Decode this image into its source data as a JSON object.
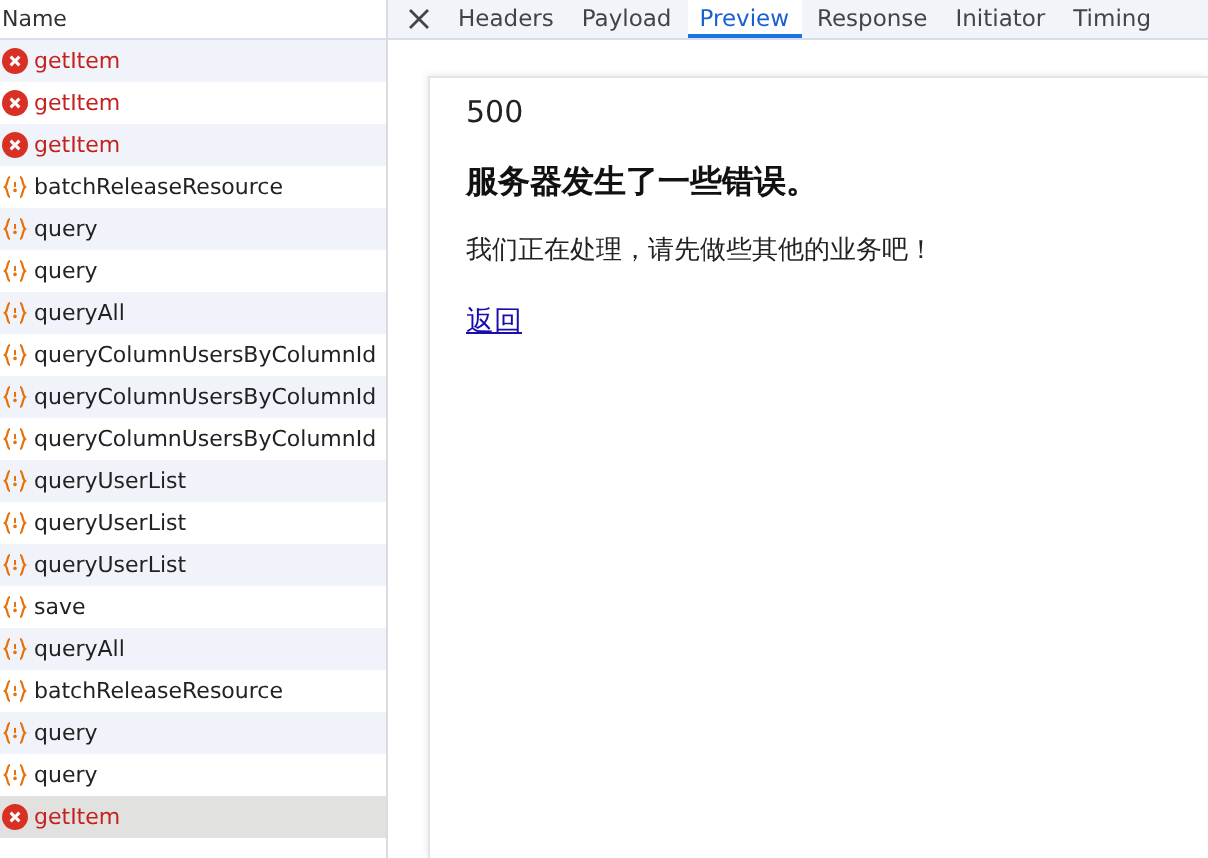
{
  "requests": {
    "column": "Name",
    "rows": [
      {
        "name": "getItem",
        "kind": "error",
        "selected": false
      },
      {
        "name": "getItem",
        "kind": "error",
        "selected": false
      },
      {
        "name": "getItem",
        "kind": "error",
        "selected": false
      },
      {
        "name": "batchReleaseResource",
        "kind": "fetch",
        "selected": false
      },
      {
        "name": "query",
        "kind": "fetch",
        "selected": false
      },
      {
        "name": "query",
        "kind": "fetch",
        "selected": false
      },
      {
        "name": "queryAll",
        "kind": "fetch",
        "selected": false
      },
      {
        "name": "queryColumnUsersByColumnId",
        "kind": "fetch",
        "selected": false
      },
      {
        "name": "queryColumnUsersByColumnId",
        "kind": "fetch",
        "selected": false
      },
      {
        "name": "queryColumnUsersByColumnId",
        "kind": "fetch",
        "selected": false
      },
      {
        "name": "queryUserList",
        "kind": "fetch",
        "selected": false
      },
      {
        "name": "queryUserList",
        "kind": "fetch",
        "selected": false
      },
      {
        "name": "queryUserList",
        "kind": "fetch",
        "selected": false
      },
      {
        "name": "save",
        "kind": "fetch",
        "selected": false
      },
      {
        "name": "queryAll",
        "kind": "fetch",
        "selected": false
      },
      {
        "name": "batchReleaseResource",
        "kind": "fetch",
        "selected": false
      },
      {
        "name": "query",
        "kind": "fetch",
        "selected": false
      },
      {
        "name": "query",
        "kind": "fetch",
        "selected": false
      },
      {
        "name": "getItem",
        "kind": "error",
        "selected": true
      }
    ]
  },
  "tabs": [
    {
      "label": "Headers",
      "selected": false
    },
    {
      "label": "Payload",
      "selected": false
    },
    {
      "label": "Preview",
      "selected": true
    },
    {
      "label": "Response",
      "selected": false
    },
    {
      "label": "Initiator",
      "selected": false
    },
    {
      "label": "Timing",
      "selected": false
    }
  ],
  "preview": {
    "code": "500",
    "heading": "服务器发生了一些错误。",
    "message": "我们正在处理，请先做些其他的业务吧！",
    "link": "返回"
  }
}
